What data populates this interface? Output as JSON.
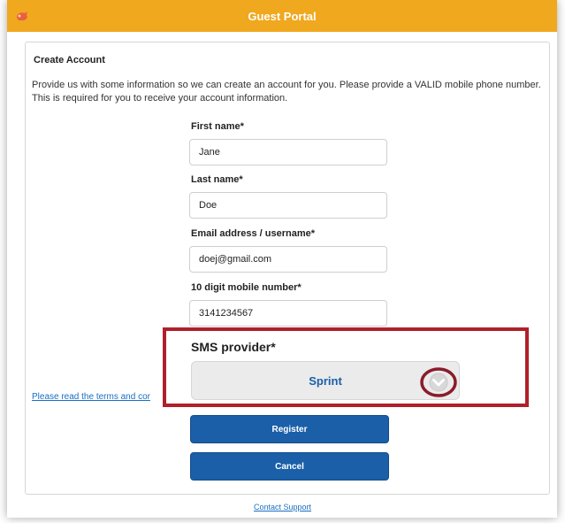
{
  "header": {
    "title": "Guest Portal",
    "logo_icon": "portal-logo-icon"
  },
  "card": {
    "title": "Create Account",
    "intro": "Provide us with some information so we can create an account for you. Please provide a VALID mobile phone number.  This is required for you to receive your account information."
  },
  "form": {
    "first_name": {
      "label": "First name*",
      "value": "Jane"
    },
    "last_name": {
      "label": "Last name*",
      "value": "Doe"
    },
    "email": {
      "label": "Email address / username*",
      "value": "doej@gmail.com"
    },
    "mobile": {
      "label": "10 digit mobile number*",
      "value": "3141234567"
    },
    "sms_provider": {
      "label": "SMS provider*",
      "selected": "Sprint"
    }
  },
  "terms_link": "Please read the terms and cor",
  "buttons": {
    "register": "Register",
    "cancel": "Cancel"
  },
  "footer": {
    "support_link": "Contact Support"
  },
  "colors": {
    "header": "#f0a81e",
    "button": "#1a5fa8",
    "highlight": "#b0202a"
  }
}
